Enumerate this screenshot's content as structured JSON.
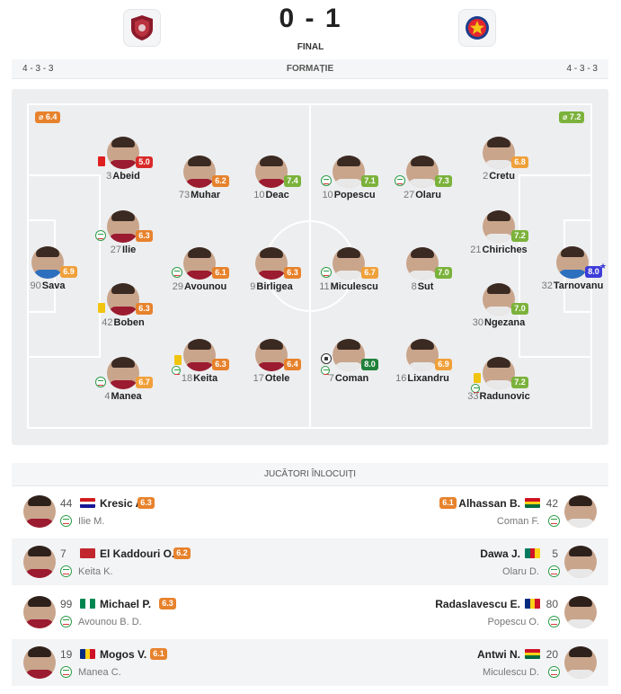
{
  "match": {
    "score": "0 - 1",
    "status": "FINAL",
    "home_crest": "cfr-cluj-crest-icon",
    "away_crest": "fcsb-crest-icon"
  },
  "formation": {
    "home": "4 - 3 - 3",
    "label": "FORMAȚIE",
    "away": "4 - 3 - 3"
  },
  "team_avg": {
    "home": "⌀ 6.4",
    "away": "⌀ 7.2"
  },
  "colors": {
    "green": "#2fa04b",
    "light_green": "#7bb23b",
    "orange": "#e7822c",
    "light_orange": "#f0a03a",
    "red": "#d92a2a",
    "dark_green": "#21813b",
    "blue_top": "#3d3bd8",
    "pitch": "#edeef0"
  },
  "players": [
    {
      "num": "3",
      "name": "Abeid",
      "rating": "5.0",
      "color": "c-red",
      "icon": "red-card-icon",
      "side": "home"
    },
    {
      "num": "73",
      "name": "Muhar",
      "rating": "6.2",
      "color": "c-orange",
      "icon": "",
      "side": "home"
    },
    {
      "num": "10",
      "name": "Deac",
      "rating": "7.4",
      "color": "c-lgreen",
      "icon": "",
      "side": "home"
    },
    {
      "num": "27",
      "name": "Ilie",
      "rating": "6.3",
      "color": "c-orange",
      "icon": "substitution-icon",
      "side": "home"
    },
    {
      "num": "90",
      "name": "Sava",
      "rating": "6.9",
      "color": "c-lorange",
      "icon": "",
      "side": "gk-home"
    },
    {
      "num": "29",
      "name": "Avounou",
      "rating": "6.1",
      "color": "c-orange",
      "icon": "substitution-icon",
      "side": "home"
    },
    {
      "num": "9",
      "name": "Birligea",
      "rating": "6.3",
      "color": "c-orange",
      "icon": "",
      "side": "home"
    },
    {
      "num": "42",
      "name": "Boben",
      "rating": "6.3",
      "color": "c-orange",
      "icon": "yellow-card-icon",
      "side": "home"
    },
    {
      "num": "4",
      "name": "Manea",
      "rating": "6.7",
      "color": "c-lorange",
      "icon": "substitution-icon",
      "side": "home"
    },
    {
      "num": "18",
      "name": "Keita",
      "rating": "6.3",
      "color": "c-orange",
      "icon": "yellow-sub-icon",
      "side": "home"
    },
    {
      "num": "17",
      "name": "Otele",
      "rating": "6.4",
      "color": "c-orange",
      "icon": "",
      "side": "home"
    },
    {
      "num": "10",
      "name": "Popescu",
      "rating": "7.1",
      "color": "c-lgreen",
      "icon": "substitution-icon",
      "side": "away"
    },
    {
      "num": "27",
      "name": "Olaru",
      "rating": "7.3",
      "color": "c-lgreen",
      "icon": "substitution-icon",
      "side": "away"
    },
    {
      "num": "2",
      "name": "Cretu",
      "rating": "6.8",
      "color": "c-lorange",
      "icon": "",
      "side": "away"
    },
    {
      "num": "21",
      "name": "Chiriches",
      "rating": "7.2",
      "color": "c-lgreen",
      "icon": "",
      "side": "away"
    },
    {
      "num": "32",
      "name": "Tarnovanu",
      "rating": "8.0",
      "color": "c-blue",
      "icon": "",
      "side": "gk-away"
    },
    {
      "num": "11",
      "name": "Miculescu",
      "rating": "6.7",
      "color": "c-lorange",
      "icon": "substitution-icon",
      "side": "away"
    },
    {
      "num": "8",
      "name": "Sut",
      "rating": "7.0",
      "color": "c-lgreen",
      "icon": "",
      "side": "away"
    },
    {
      "num": "30",
      "name": "Ngezana",
      "rating": "7.0",
      "color": "c-lgreen",
      "icon": "",
      "side": "away"
    },
    {
      "num": "7",
      "name": "Coman",
      "rating": "8.0",
      "color": "c-dgreen",
      "icon": "goal-sub-icon",
      "side": "away"
    },
    {
      "num": "16",
      "name": "Lixandru",
      "rating": "6.9",
      "color": "c-lorange",
      "icon": "",
      "side": "away"
    },
    {
      "num": "33",
      "name": "Radunovic",
      "rating": "7.2",
      "color": "c-lgreen",
      "icon": "yellow-sub-icon",
      "side": "away"
    }
  ],
  "substitutes": {
    "title": "JUCĂTORI ÎNLOCUIȚI",
    "rows": [
      {
        "home": {
          "num": "44",
          "name": "Kresic A.",
          "rating": "6.3",
          "color": "c-orange",
          "out": "Ilie M.",
          "flag": "croatia-flag"
        },
        "away": {
          "num": "42",
          "name": "Alhassan B.",
          "rating": "6.1",
          "color": "c-orange",
          "out": "Coman F.",
          "flag": "ghana-flag"
        }
      },
      {
        "home": {
          "num": "7",
          "name": "El Kaddouri O.",
          "rating": "6.2",
          "color": "c-orange",
          "out": "Keita K.",
          "flag": "morocco-flag"
        },
        "away": {
          "num": "5",
          "name": "Dawa J.",
          "rating": "",
          "color": "",
          "out": "Olaru D.",
          "flag": "cameroon-flag"
        }
      },
      {
        "home": {
          "num": "99",
          "name": "Michael P.",
          "rating": "6.3",
          "color": "c-orange",
          "out": "Avounou B. D.",
          "flag": "nigeria-flag"
        },
        "away": {
          "num": "80",
          "name": "Radaslavescu E.",
          "rating": "",
          "color": "",
          "out": "Popescu O.",
          "flag": "romania-flag"
        }
      },
      {
        "home": {
          "num": "19",
          "name": "Mogos V.",
          "rating": "6.1",
          "color": "c-orange",
          "out": "Manea C.",
          "flag": "romania-flag"
        },
        "away": {
          "num": "20",
          "name": "Antwi N.",
          "rating": "",
          "color": "",
          "out": "Miculescu D.",
          "flag": "ghana-flag"
        }
      }
    ]
  }
}
